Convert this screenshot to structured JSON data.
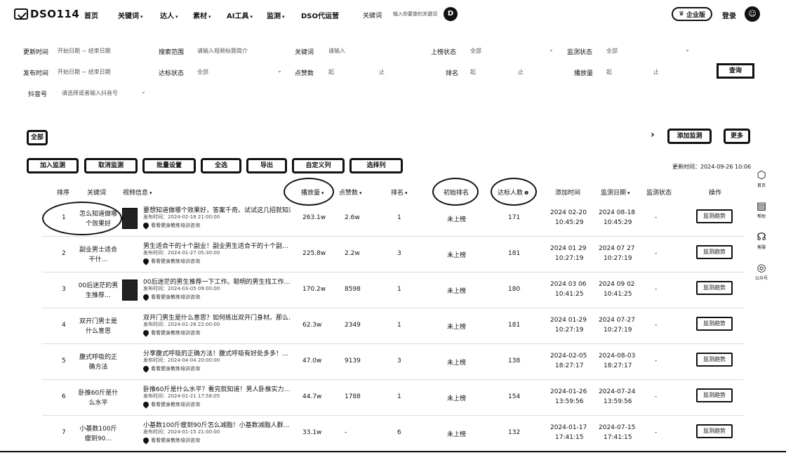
{
  "nav": {
    "logo_text": "DSO114",
    "items": [
      {
        "label": "首页",
        "caret": ""
      },
      {
        "label": "关键词",
        "caret": "▾"
      },
      {
        "label": "达人",
        "caret": "▾"
      },
      {
        "label": "素材",
        "caret": "▾"
      },
      {
        "label": "AI工具",
        "caret": "▾"
      },
      {
        "label": "监测",
        "caret": "▾"
      },
      {
        "label": "DSO代运营",
        "caret": ""
      }
    ],
    "keyword_label": "关键词",
    "keyword_placeholder": "输入你要查的关键词",
    "enterprise_label": "企业版",
    "login_label": "登录",
    "circle_glyph": "D",
    "avatar_glyph": "☺"
  },
  "filters": {
    "update_time": {
      "label": "更新时间",
      "value": "开始日期 ~ 结束日期"
    },
    "search_scope": {
      "label": "搜索范围",
      "value": "请输入视频标题简介"
    },
    "keyword": {
      "label": "关键词",
      "value": "请输入"
    },
    "rank_status": {
      "label": "上榜状态",
      "value": "全部"
    },
    "monitor_status": {
      "label": "监测状态",
      "value": "全部"
    },
    "publish_time": {
      "label": "发布时间",
      "value": "开始日期 ~ 结束日期"
    },
    "target_status": {
      "label": "达标状态",
      "value": "全部"
    },
    "likes": {
      "label": "点赞数",
      "from": "起",
      "to": "止"
    },
    "rank": {
      "label": "排名",
      "from": "起",
      "to": "止"
    },
    "plays": {
      "label": "播放量",
      "from": "起",
      "to": "止"
    },
    "douyin_id": {
      "label": "抖音号",
      "value": "请选择或者输入抖音号"
    },
    "query_button": "查询"
  },
  "toolbar": {
    "all_label": "全部",
    "buttons": [
      "加入监测",
      "取消监测",
      "批量设置",
      "全选",
      "导出",
      "自定义列",
      "选择列"
    ],
    "right_buttons": [
      "添加监测",
      "更多"
    ],
    "update_time_text": "更新时间：2024-09-26 10:06"
  },
  "table": {
    "headers": [
      {
        "label": "排序",
        "caret": ""
      },
      {
        "label": "关键词",
        "caret": ""
      },
      {
        "label": "视频信息",
        "caret": "▾"
      },
      {
        "label": "播放量",
        "caret": "▾"
      },
      {
        "label": "点赞数",
        "caret": "▾"
      },
      {
        "label": "排名",
        "caret": "▾"
      },
      {
        "label": "初始排名",
        "caret": ""
      },
      {
        "label": "达标人数",
        "caret": "❶"
      },
      {
        "label": "添加时间",
        "caret": ""
      },
      {
        "label": "监测日期",
        "caret": "▾"
      },
      {
        "label": "监测状态",
        "caret": ""
      },
      {
        "label": "操作",
        "caret": ""
      }
    ],
    "rows": [
      {
        "no": "1",
        "keyword": "怎么知道做哪个效果好",
        "has_thumb": true,
        "title": "要想知道做哪个效果好，答案千奇。试试这几招就知道…",
        "date": "发布时间：2024-02-18 21:00:00",
        "author": "看看健身教练培训咨询",
        "plays": "263.1w",
        "likes": "2.6w",
        "rank": "1",
        "initial": "未上榜",
        "reach": "171",
        "added_date": "2024 02-20",
        "added_time": "10:45:29",
        "mon_date": "2024 08-18",
        "mon_time": "10:45:29",
        "status": "-",
        "action": "监测趋势"
      },
      {
        "no": "2",
        "keyword": "副业男士适合干什…",
        "has_thumb": false,
        "title": "男生适合干的十个副业！副业男生适合干的十个副…",
        "date": "发布时间：2024-01-27 05:30:00",
        "author": "看看健身教练培训咨询",
        "plays": "225.8w",
        "likes": "2.2w",
        "rank": "3",
        "initial": "未上榜",
        "reach": "181",
        "added_date": "2024 01 29",
        "added_time": "10:27:19",
        "mon_date": "2024 07 27",
        "mon_time": "10:27:19",
        "status": "-",
        "action": "监测趋势"
      },
      {
        "no": "3",
        "keyword": "00后迷茫的男生推荐…",
        "has_thumb": true,
        "title": "00后迷茫的男生推荐一下工作。聪明的男生找工作…",
        "date": "发布时间：2024-03-05 09:00:00",
        "author": "看看健身教练培训咨询",
        "plays": "170.2w",
        "likes": "8598",
        "rank": "1",
        "initial": "未上榜",
        "reach": "180",
        "added_date": "2024 03 06",
        "added_time": "10:41:25",
        "mon_date": "2024 09 02",
        "mon_time": "10:41:25",
        "status": "-",
        "action": "监测趋势"
      },
      {
        "no": "4",
        "keyword": "双开门男士是什么意思",
        "has_thumb": false,
        "title": "双开门男生是什么意思？如何练出双开门身材。那么…",
        "date": "发布时间：2024-01-26 22:00:00",
        "author": "看看健身教练培训咨询",
        "plays": "62.3w",
        "likes": "2349",
        "rank": "1",
        "initial": "未上榜",
        "reach": "181",
        "added_date": "2024 01-29",
        "added_time": "10:27:19",
        "mon_date": "2024 07-27",
        "mon_time": "10:27:19",
        "status": "-",
        "action": "监测趋势"
      },
      {
        "no": "5",
        "keyword": "腹式呼吸的正确方法",
        "has_thumb": false,
        "title": "分享腹式呼吸的正确方法！腹式呼吸有好处多多！…",
        "date": "发布时间：2024-04-04 20:00:00",
        "author": "看看健身教练培训咨询",
        "plays": "47.0w",
        "likes": "9139",
        "rank": "3",
        "initial": "未上榜",
        "reach": "138",
        "added_date": "2024-02-05",
        "added_time": "18:27:17",
        "mon_date": "2024-08-03",
        "mon_time": "18:27:17",
        "status": "-",
        "action": "监测趋势"
      },
      {
        "no": "6",
        "keyword": "卧推60斤是什么水平",
        "has_thumb": false,
        "title": "卧推60斤是什么水平？看完就知道！男人卧推实力…",
        "date": "发布时间：2024-01-21 17:58:05",
        "author": "看看健身教练培训咨询",
        "plays": "44.7w",
        "likes": "1788",
        "rank": "1",
        "initial": "未上榜",
        "reach": "154",
        "added_date": "2024-01-26",
        "added_time": "13:59:56",
        "mon_date": "2024-07-24",
        "mon_time": "13:59:56",
        "status": "-",
        "action": "监测趋势"
      },
      {
        "no": "7",
        "keyword": "小基数100斤瘦到90…",
        "has_thumb": false,
        "title": "小基数100斤瘦到90斤怎么减脂！小基数减脂人群…",
        "date": "发布时间：2024-01-15 21:00:00",
        "author": "看看健身教练培训咨询",
        "plays": "33.1w",
        "likes": "-",
        "rank": "6",
        "initial": "未上榜",
        "reach": "132",
        "added_date": "2024-01-17",
        "added_time": "17:41:15",
        "mon_date": "2024-07-15",
        "mon_time": "17:41:15",
        "status": "-",
        "action": "监测趋势"
      }
    ]
  },
  "rail": [
    {
      "icon": "hexagon-icon",
      "glyph": "⬡",
      "label": "首页"
    },
    {
      "icon": "book-icon",
      "glyph": "▤",
      "label": "帮助"
    },
    {
      "icon": "headset-icon",
      "glyph": "☊",
      "label": "客服"
    },
    {
      "icon": "wechat-icon",
      "glyph": "◎",
      "label": "公众号"
    }
  ]
}
